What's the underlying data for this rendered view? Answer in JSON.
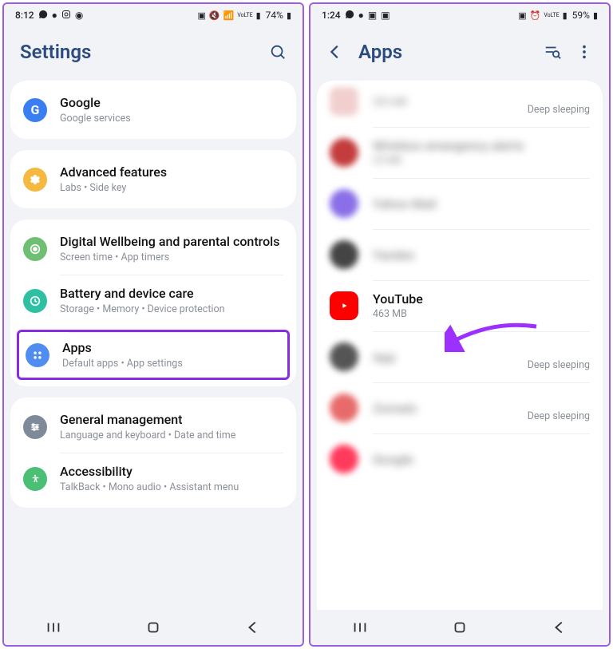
{
  "left": {
    "statusbar": {
      "time": "8:12",
      "battery": "74%"
    },
    "header": {
      "title": "Settings"
    },
    "items": {
      "google": {
        "title": "Google",
        "sub": "Google services"
      },
      "advanced": {
        "title": "Advanced features",
        "sub": "Labs  •  Side key"
      },
      "wellbeing": {
        "title": "Digital Wellbeing and parental controls",
        "sub": "Screen time  •  App timers"
      },
      "battery": {
        "title": "Battery and device care",
        "sub": "Storage  •  Memory  •  Device protection"
      },
      "apps": {
        "title": "Apps",
        "sub": "Default apps  •  App settings"
      },
      "general": {
        "title": "General management",
        "sub": "Language and keyboard  •  Date and time"
      },
      "accessibility": {
        "title": "Accessibility",
        "sub": "TalkBack  •  Mono audio  •  Assistant menu"
      }
    }
  },
  "right": {
    "statusbar": {
      "time": "1:24",
      "battery": "59%"
    },
    "header": {
      "title": "Apps"
    },
    "apps": {
      "partial": {
        "sub": "303 MB",
        "status": "Deep sleeping"
      },
      "b1": {
        "name": "Wireless emergency alerts",
        "sub": "25 MB"
      },
      "b2": {
        "name": "Yahoo Mail",
        "sub": ""
      },
      "b3": {
        "name": "Yandex",
        "sub": ""
      },
      "youtube": {
        "name": "YouTube",
        "sub": "463 MB"
      },
      "b4": {
        "name": "App",
        "sub": "",
        "status": "Deep sleeping"
      },
      "b5": {
        "name": "Zomato",
        "sub": "",
        "status": "Deep sleeping"
      },
      "b6": {
        "name": "Google",
        "sub": ""
      }
    }
  }
}
